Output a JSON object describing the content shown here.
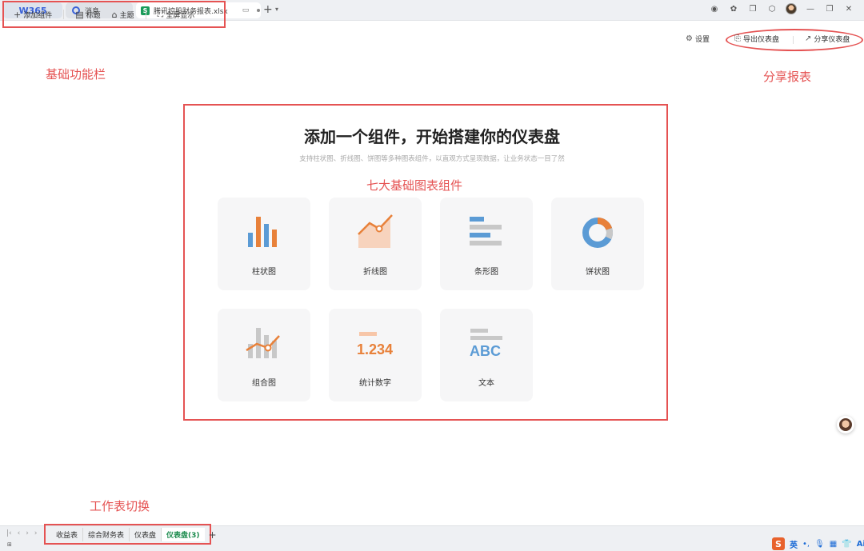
{
  "titlebar": {
    "brand": "W365",
    "tabs": [
      {
        "label": "消息"
      },
      {
        "label": "腾讯控股财务报表.xlsx",
        "badge": "S"
      }
    ]
  },
  "toolbar": {
    "add_component": "添加组件",
    "title": "标题",
    "theme": "主题",
    "fullscreen": "全屏显示",
    "settings": "设置",
    "export": "导出仪表盘",
    "share": "分享仪表盘"
  },
  "annotations": {
    "basic_toolbar": "基础功能栏",
    "share_report": "分享报表",
    "seven_components": "七大基础图表组件",
    "sheet_switch": "工作表切换"
  },
  "main": {
    "title": "添加一个组件，开始搭建你的仪表盘",
    "subtitle": "支持柱状图、折线图、饼图等多种图表组件，以直观方式呈现数据，让业务状态一目了然"
  },
  "components": [
    {
      "label": "柱状图",
      "icon": "bar-chart-icon"
    },
    {
      "label": "折线图",
      "icon": "line-chart-icon"
    },
    {
      "label": "条形图",
      "icon": "horizontal-bar-icon"
    },
    {
      "label": "饼状图",
      "icon": "donut-chart-icon"
    },
    {
      "label": "组合图",
      "icon": "combo-chart-icon"
    },
    {
      "label": "统计数字",
      "icon": "stat-number-icon",
      "sample": "1.234"
    },
    {
      "label": "文本",
      "icon": "text-icon",
      "sample": "ABC"
    }
  ],
  "sheets": [
    {
      "label": "收益表"
    },
    {
      "label": "综合财务表"
    },
    {
      "label": "仪表盘"
    },
    {
      "label": "仪表盘(3)",
      "active": true
    }
  ],
  "ime": {
    "lang": "英",
    "ai": "Ai"
  },
  "colors": {
    "accent_red": "#e55353",
    "orange": "#e8813a",
    "blue": "#5b9bd5",
    "gray": "#c8c8c8",
    "active_sheet": "#1a8a4c"
  }
}
